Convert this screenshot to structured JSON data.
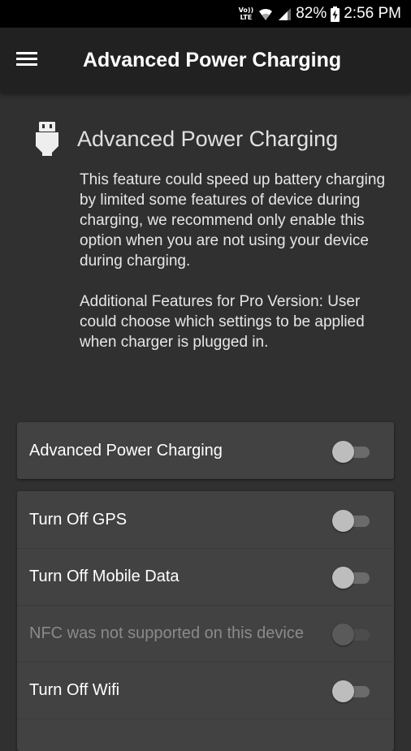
{
  "status_bar": {
    "volte_line1": "Vo))",
    "volte_line2": "LTE",
    "battery": "82%",
    "time": "2:56 PM",
    "icons": [
      "volte-lte-icon",
      "wifi-icon",
      "signal-icon",
      "battery-charging-icon"
    ]
  },
  "app_bar": {
    "title": "Advanced Power Charging",
    "menu_icon": "hamburger-menu-icon"
  },
  "header": {
    "icon": "usb-plug-icon",
    "title": "Advanced Power Charging",
    "description": "This feature could speed up battery charging by limited some features of device during charging, we recommend only enable this option when you are not using your device during charging.",
    "pro_note": "Additional Features for Pro Version: User could choose which settings to be applied when charger is plugged in."
  },
  "main_toggle": {
    "label": "Advanced Power Charging",
    "enabled": false
  },
  "settings": [
    {
      "label": "Turn Off GPS",
      "enabled": false,
      "disabled": false
    },
    {
      "label": "Turn Off Mobile Data",
      "enabled": false,
      "disabled": false
    },
    {
      "label": "NFC was not supported on this device",
      "enabled": false,
      "disabled": true
    },
    {
      "label": "Turn Off Wifi",
      "enabled": false,
      "disabled": false
    }
  ],
  "colors": {
    "background": "#303030",
    "app_bar": "#212121",
    "card": "#424242",
    "status_bar": "#000000"
  }
}
